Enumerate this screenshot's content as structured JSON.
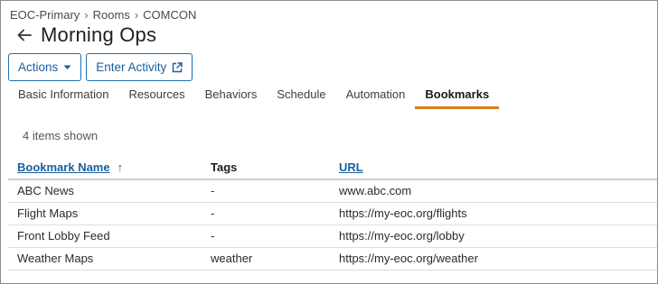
{
  "breadcrumb": {
    "items": [
      "EOC-Primary",
      "Rooms",
      "COMCON"
    ],
    "separator": "›"
  },
  "page": {
    "title": "Morning Ops"
  },
  "actions": {
    "actions_label": "Actions",
    "enter_activity_label": "Enter Activity"
  },
  "tabs": [
    {
      "label": "Basic Information",
      "active": false
    },
    {
      "label": "Resources",
      "active": false
    },
    {
      "label": "Behaviors",
      "active": false
    },
    {
      "label": "Schedule",
      "active": false
    },
    {
      "label": "Automation",
      "active": false
    },
    {
      "label": "Bookmarks",
      "active": true
    }
  ],
  "table": {
    "count_text": "4 items shown",
    "headers": {
      "name": "Bookmark Name",
      "tags": "Tags",
      "url": "URL"
    },
    "sort_indicator": "↑",
    "rows": [
      {
        "name": "ABC News",
        "tags": "-",
        "url": "www.abc.com"
      },
      {
        "name": "Flight Maps",
        "tags": "-",
        "url": "https://my-eoc.org/flights"
      },
      {
        "name": "Front Lobby Feed",
        "tags": "-",
        "url": "https://my-eoc.org/lobby"
      },
      {
        "name": "Weather Maps",
        "tags": "weather",
        "url": "https://my-eoc.org/weather"
      }
    ]
  },
  "colors": {
    "accent": "#e07b17",
    "link": "#1a5f9e",
    "button_border": "#1a6fb0"
  },
  "icons": {
    "back": "arrow-left-icon",
    "actions_caret": "caret-down-icon",
    "external": "external-link-icon"
  }
}
